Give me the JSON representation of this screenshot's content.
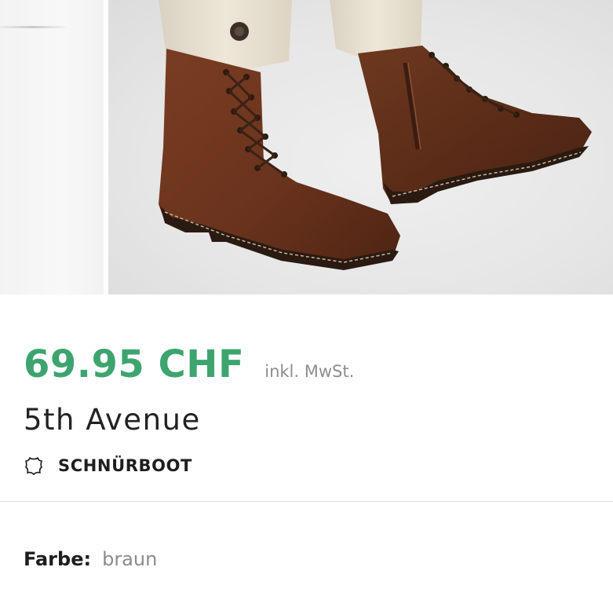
{
  "product": {
    "price": "69.95 CHF",
    "vat_note": "inkl. MwSt.",
    "brand": "5th Avenue",
    "category": "SCHNÜRBOOT",
    "category_icon": "leather-icon",
    "color_label": "Farbe:",
    "color_value": "braun"
  },
  "colors": {
    "price": "#3ea46f",
    "boot_leather": "#6b3520",
    "trousers": "#ece4d4"
  }
}
